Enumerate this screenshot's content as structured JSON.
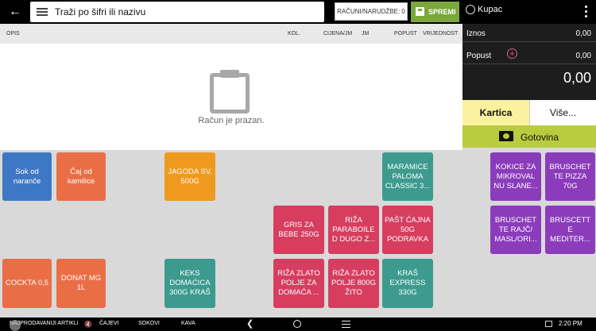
{
  "topbar": {
    "search_placeholder": "Traži po šifri ili nazivu",
    "orders_label": "RAČUNI/NARUDŽBE: 0",
    "save_label": "SPREMI",
    "customer_label": "Kupac"
  },
  "columns": [
    "OPIS",
    "KOL.",
    "CIJENA/JM",
    "JM",
    "POPUST",
    "VRIJEDNOST"
  ],
  "receipt": {
    "empty_text": "Račun je prazan."
  },
  "totals": {
    "amount_label": "Iznos",
    "amount_value": "0,00",
    "discount_label": "Popust",
    "discount_value": "0,00",
    "total_value": "0,00"
  },
  "payment": {
    "card_label": "Kartica",
    "more_label": "Više...",
    "cash_label": "Gotovina"
  },
  "products": [
    {
      "label": "Sok od naranče",
      "color": "blue"
    },
    {
      "label": "Čaj od kamilice",
      "color": "orange"
    },
    {
      "label": "JAGODA SV. 500G",
      "color": "gold"
    },
    {
      "label": "MARAMICE PALOMA CLASSIC 3...",
      "color": "teal"
    },
    {
      "label": "KOKICE ZA MIKROVAL NU SLANE...",
      "color": "purple"
    },
    {
      "label": "BRUSCHET TE PIZZA 70G",
      "color": "purple"
    },
    {
      "label": "GRIS ZA BEBE 250G",
      "color": "red"
    },
    {
      "label": "RIŽA PARABOILE D DUGO Z...",
      "color": "red"
    },
    {
      "label": "PAŠT ĆAJNA 50G PODRAVKA",
      "color": "red"
    },
    {
      "label": "BRUSCHET TE RAJČ/ MASL/ORI...",
      "color": "purple"
    },
    {
      "label": "BRUSCETT E MEDITER...",
      "color": "purple"
    },
    {
      "label": "COCKTA 0,5",
      "color": "orange"
    },
    {
      "label": "DONAT MG 1L",
      "color": "orange"
    },
    {
      "label": "KEKS DOMAĆICA 300G KRAŠ",
      "color": "teal"
    },
    {
      "label": "RIŽA ZLATO POLJE ZA DOMAĆA ...",
      "color": "red"
    },
    {
      "label": "RIŽA ZLATO POLJE 800G ŽITO",
      "color": "red"
    },
    {
      "label": "KRAŠ EXPRESS 330G",
      "color": "teal"
    }
  ],
  "categories": [
    "NAJPRODAVANIJI ARTIKLI",
    "ČAJEVI",
    "SOKOVI",
    "KAVA"
  ],
  "status": {
    "time": "2:20 PM"
  }
}
